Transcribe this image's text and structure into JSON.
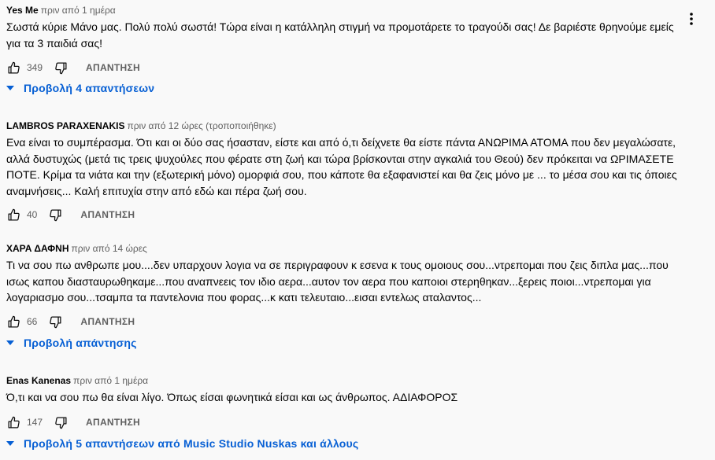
{
  "comments": [
    {
      "author": "Yes Me",
      "time": "πριν από 1 ημέρα",
      "text": "Σωστά κύριε Μάνο μας. Πολύ πολύ σωστά! Τώρα είναι η κατάλληλη στιγμή να προμοτάρετε το τραγούδι σας! Δε βαριέστε θρηνούμε εμείς για τα 3 παιδιά σας!",
      "likes": "349",
      "reply_label": "ΑΠΑΝΤΗΣΗ",
      "replies_label": "Προβολή 4 απαντήσεων"
    },
    {
      "author": "LAMBROS PARAXENAKIS",
      "time": "πριν από 12 ώρες (τροποποιήθηκε)",
      "text": "Ενα είναι το συμπέρασμα. Ότι και οι δύο σας ήσασταν, είστε και από ό,τι δείχνετε θα είστε πάντα ΑΝΩΡΙΜΑ ΑΤΟΜΑ που δεν μεγαλώσατε, αλλά δυστυχώς (μετά τις τρεις ψυχούλες που φέρατε στη ζωή και τώρα βρίσκονται στην αγκαλιά του Θεού) δεν πρόκειται να ΩΡΙΜΑΣΕΤΕ ΠΟΤΕ. Κρίμα τα νιάτα και την (εξωτερική μόνο) ομορφιά σου, που κάποτε θα εξαφανιστεί και θα ζεις μόνο με ... το μέσα σου και τις όποιες αναμνήσεις... Καλή επιτυχία στην από εδώ και πέρα ζωή σου.",
      "likes": "40",
      "reply_label": "ΑΠΑΝΤΗΣΗ"
    },
    {
      "author": "ΧΑΡΑ ΔΑΦΝΗ",
      "time": "πριν από 14 ώρες",
      "text": "Τι να σου πω ανθρωπε μου....δεν υπαρχουν λογια να σε περιγραφουν κ εσενα κ τους ομοιους σου...ντρεπομαι που ζεις διπλα μας...που ισως καπου διασταυρωθηκαμε...που αναπνεεις τον ιδιο αερα...αυτον τον αερα που καποιοι στερηθηκαν...ξερεις ποιοι...ντρεπομαι για λογαριασμο σου...τσαμπα τα παντελονια που φορας...κ κατι τελευταιο...εισαι εντελως αταλαντος...",
      "likes": "66",
      "reply_label": "ΑΠΑΝΤΗΣΗ",
      "replies_label": "Προβολή απάντησης"
    },
    {
      "author": "Enas Kanenas",
      "time": "πριν από 1 ημέρα",
      "text": "Ό,τι και να σου πω θα είναι λίγο. Όπως είσαι φωνητικά είσαι και ως άνθρωπος. ΑΔΙΑΦΟΡΟΣ",
      "likes": "147",
      "reply_label": "ΑΠΑΝΤΗΣΗ",
      "replies_label": "Προβολή 5 απαντήσεων από Music Studio Nuskas και άλλους"
    }
  ],
  "icons": {
    "like": "thumb-up-icon",
    "dislike": "thumb-down-icon",
    "expand": "caret-down-icon",
    "menu": "more-vert-icon"
  },
  "colors": {
    "background": "#f9f9f9",
    "link": "#065fd4",
    "secondary": "#606060"
  }
}
